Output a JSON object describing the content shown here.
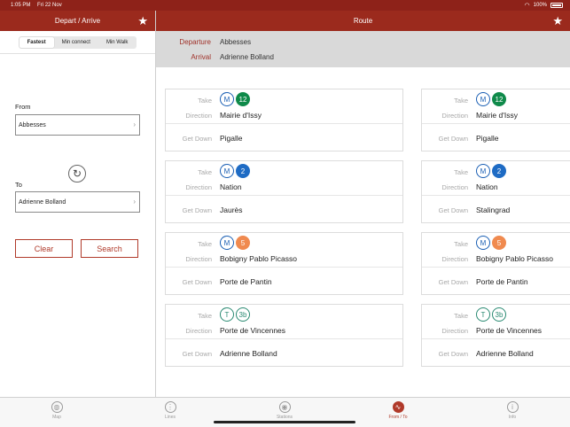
{
  "status": {
    "time": "1:05 PM",
    "date": "Fri 22 Nov",
    "battery": "100%"
  },
  "left": {
    "title": "Depart / Arrive",
    "segments": [
      {
        "label": "Fastest"
      },
      {
        "label": "Min connect"
      },
      {
        "label": "Min Walk"
      }
    ],
    "from_label": "From",
    "from_value": "Abbesses",
    "to_label": "To",
    "to_value": "Adrienne Bolland",
    "clear_label": "Clear",
    "search_label": "Search"
  },
  "right": {
    "title": "Route",
    "departure_label": "Departure",
    "departure_value": "Abbesses",
    "arrival_label": "Arrival",
    "arrival_value": "Adrienne Bolland"
  },
  "labels": {
    "take": "Take",
    "direction": "Direction",
    "get_down": "Get Down"
  },
  "colors": {
    "metro": "#1a5fb4",
    "tram": "#2a8a72",
    "line12": "#0f8a4a",
    "line2": "#1e6bc4",
    "line5": "#f08a4f",
    "accent": "#9b2a1d"
  },
  "routes": [
    {
      "steps": [
        {
          "mode": "M",
          "line": "12",
          "line_color": "#0f8a4a",
          "line_style": "fill",
          "direction": "Mairie d'Issy",
          "get_down": "Pigalle"
        },
        {
          "mode": "M",
          "line": "2",
          "line_color": "#1e6bc4",
          "line_style": "fill",
          "direction": "Nation",
          "get_down": "Jaurès"
        },
        {
          "mode": "M",
          "line": "5",
          "line_color": "#f08a4f",
          "line_style": "fill",
          "direction": "Bobigny Pablo Picasso",
          "get_down": "Porte de Pantin"
        },
        {
          "mode": "T",
          "line": "3b",
          "line_color": "#2a8a72",
          "line_style": "outline",
          "direction": "Porte de Vincennes",
          "get_down": "Adrienne Bolland"
        }
      ]
    },
    {
      "steps": [
        {
          "mode": "M",
          "line": "12",
          "line_color": "#0f8a4a",
          "line_style": "fill",
          "direction": "Mairie d'Issy",
          "get_down": "Pigalle"
        },
        {
          "mode": "M",
          "line": "2",
          "line_color": "#1e6bc4",
          "line_style": "fill",
          "direction": "Nation",
          "get_down": "Stalingrad"
        },
        {
          "mode": "M",
          "line": "5",
          "line_color": "#f08a4f",
          "line_style": "fill",
          "direction": "Bobigny Pablo Picasso",
          "get_down": "Porte de Pantin"
        },
        {
          "mode": "T",
          "line": "3b",
          "line_color": "#2a8a72",
          "line_style": "outline",
          "direction": "Porte de Vincennes",
          "get_down": "Adrienne Bolland"
        }
      ]
    }
  ],
  "tabs": [
    {
      "label": "Map",
      "icon": "globe-icon",
      "glyph": "◍"
    },
    {
      "label": "Lines",
      "icon": "lines-icon",
      "glyph": "⋮"
    },
    {
      "label": "Stations",
      "icon": "station-icon",
      "glyph": "◉"
    },
    {
      "label": "From / To",
      "icon": "route-icon",
      "glyph": "∿"
    },
    {
      "label": "Info",
      "icon": "info-icon",
      "glyph": "i"
    }
  ]
}
